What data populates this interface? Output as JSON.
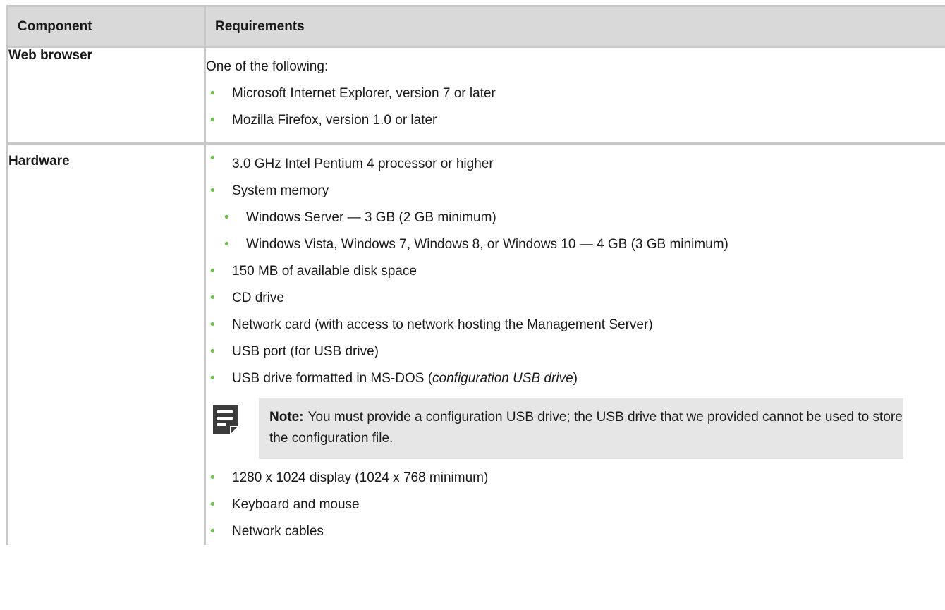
{
  "table": {
    "headers": {
      "component": "Component",
      "requirements": "Requirements"
    },
    "web_browser": {
      "component": "Web browser",
      "intro": "One of the following:",
      "items": [
        "Microsoft Internet Explorer, version 7 or later",
        "Mozilla Firefox, version 1.0 or later"
      ]
    },
    "hardware": {
      "component": "Hardware",
      "items": [
        "3.0 GHz Intel Pentium 4 processor or higher",
        "System memory"
      ],
      "memory_subitems": [
        "Windows Server — 3 GB (2 GB minimum)",
        "Windows Vista, Windows 7, Windows 8, or Windows 10 — 4 GB (3 GB minimum)"
      ],
      "items_after": [
        "150 MB of available disk space",
        "CD drive",
        "Network card (with access to network hosting the Management Server)",
        "USB port (for USB drive)"
      ],
      "usb_drive_prefix": "USB drive formatted in MS-DOS (",
      "usb_drive_italic": "configuration USB drive",
      "usb_drive_suffix": ")",
      "note": {
        "label": "Note:",
        "text": "You must provide a configuration USB drive; the USB drive that we provided cannot be used to store the configuration file."
      },
      "items_final": [
        "1280 x 1024 display (1024 x 768 minimum)",
        "Keyboard and mouse",
        "Network cables"
      ]
    }
  },
  "colors": {
    "bullet": "#6cc24a",
    "header_bg": "#d9d9d9",
    "note_bg": "#e6e6e6",
    "border": "#c8c8c8"
  },
  "icons": {
    "bullet": "•",
    "note": "note-icon"
  }
}
